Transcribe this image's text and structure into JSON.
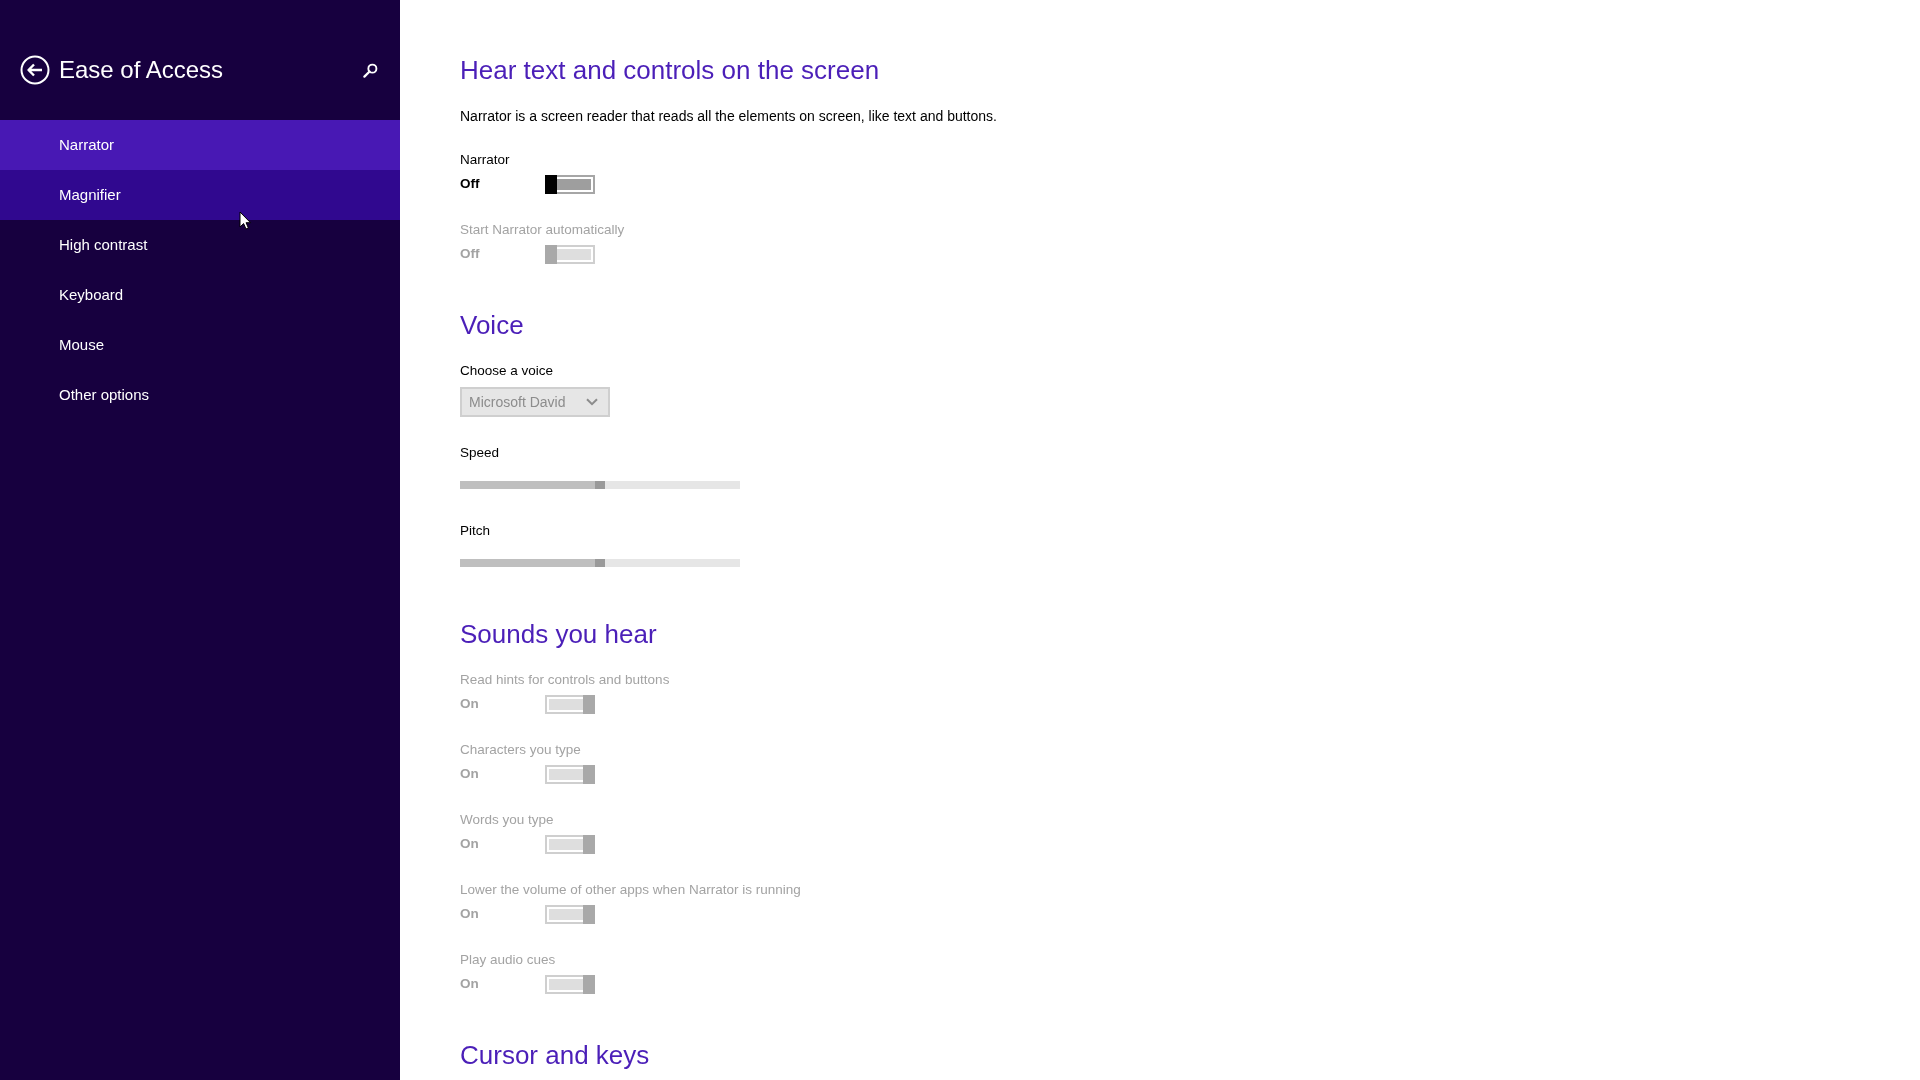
{
  "sidebar": {
    "title": "Ease of Access",
    "items": [
      {
        "label": "Narrator",
        "selected": true,
        "hovered": false
      },
      {
        "label": "Magnifier",
        "selected": false,
        "hovered": true
      },
      {
        "label": "High contrast",
        "selected": false,
        "hovered": false
      },
      {
        "label": "Keyboard",
        "selected": false,
        "hovered": false
      },
      {
        "label": "Mouse",
        "selected": false,
        "hovered": false
      },
      {
        "label": "Other options",
        "selected": false,
        "hovered": false
      }
    ]
  },
  "sections": [
    {
      "heading": "Hear text and controls on the screen",
      "description": "Narrator is a screen reader that reads all the elements on screen, like text and buttons.",
      "settings": [
        {
          "kind": "toggle",
          "label": "Narrator",
          "value": "Off",
          "on": false,
          "disabled": false
        },
        {
          "kind": "toggle",
          "label": "Start Narrator automatically",
          "value": "Off",
          "on": false,
          "disabled": true
        }
      ]
    },
    {
      "heading": "Voice",
      "settings": [
        {
          "kind": "dropdown",
          "label": "Choose a voice",
          "value": "Microsoft David",
          "disabled": true
        },
        {
          "kind": "slider",
          "label": "Speed",
          "level": 0.5,
          "disabled": true
        },
        {
          "kind": "slider",
          "label": "Pitch",
          "level": 0.5,
          "disabled": true
        }
      ]
    },
    {
      "heading": "Sounds you hear",
      "settings": [
        {
          "kind": "toggle",
          "label": "Read hints for controls and buttons",
          "value": "On",
          "on": true,
          "disabled": true
        },
        {
          "kind": "toggle",
          "label": "Characters you type",
          "value": "On",
          "on": true,
          "disabled": true
        },
        {
          "kind": "toggle",
          "label": "Words you type",
          "value": "On",
          "on": true,
          "disabled": true
        },
        {
          "kind": "toggle",
          "label": "Lower the volume of other apps when Narrator is running",
          "value": "On",
          "on": true,
          "disabled": true
        },
        {
          "kind": "toggle",
          "label": "Play audio cues",
          "value": "On",
          "on": true,
          "disabled": true
        }
      ]
    },
    {
      "heading": "Cursor and keys"
    }
  ]
}
